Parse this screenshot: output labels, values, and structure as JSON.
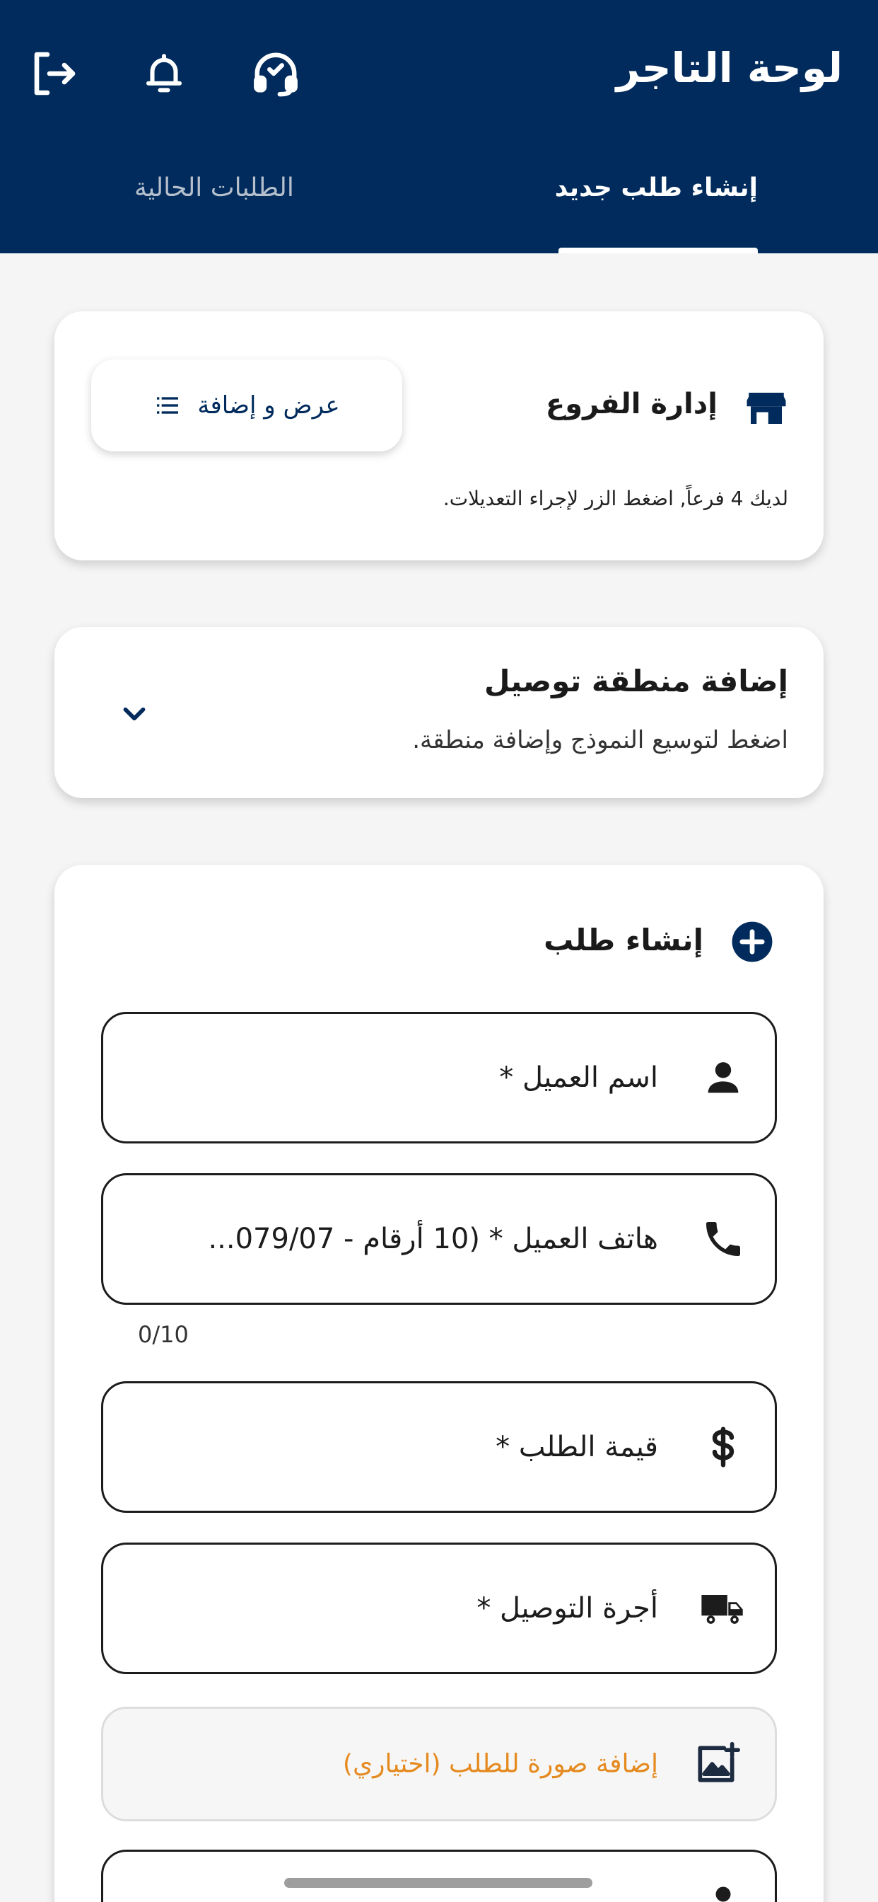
{
  "header": {
    "title": "لوحة التاجر",
    "icons": {
      "logout": "logout-icon",
      "notifications": "bell-icon",
      "support": "headset-icon"
    },
    "tabs": [
      {
        "label": "إنشاء طلب جديد",
        "active": true
      },
      {
        "label": "الطلبات الحالية",
        "active": false
      }
    ],
    "colors": {
      "primary": "#002b5c",
      "inactive_tab": "#b6bfcc"
    }
  },
  "branches": {
    "title": "إدارة الفروع",
    "icon": "store-icon",
    "button_label": "عرض و إضافة",
    "button_icon": "list-icon",
    "description": "لديك 4 فرعاً, اضغط الزر لإجراء التعديلات."
  },
  "delivery_zone": {
    "title": "إضافة منطقة توصيل",
    "subtitle": "اضغط لتوسيع النموذج وإضافة منطقة.",
    "expand_icon": "chevron-down-icon"
  },
  "order_form": {
    "title": "إنشاء طلب",
    "title_icon": "add-circle-icon",
    "fields": {
      "customer_name": {
        "label": "اسم العميل *",
        "icon": "person-icon"
      },
      "customer_phone": {
        "label": "هاتف العميل * (10 أرقام - 079/07...",
        "icon": "phone-icon",
        "counter": "0/10"
      },
      "order_value": {
        "label": "قيمة الطلب *",
        "icon": "dollar-icon"
      },
      "delivery_fee": {
        "label": "أجرة التوصيل *",
        "icon": "truck-icon"
      }
    },
    "image_upload": {
      "label": "إضافة صورة للطلب (اختياري)",
      "icon": "add-photo-icon",
      "color": "#e58a1f"
    }
  }
}
